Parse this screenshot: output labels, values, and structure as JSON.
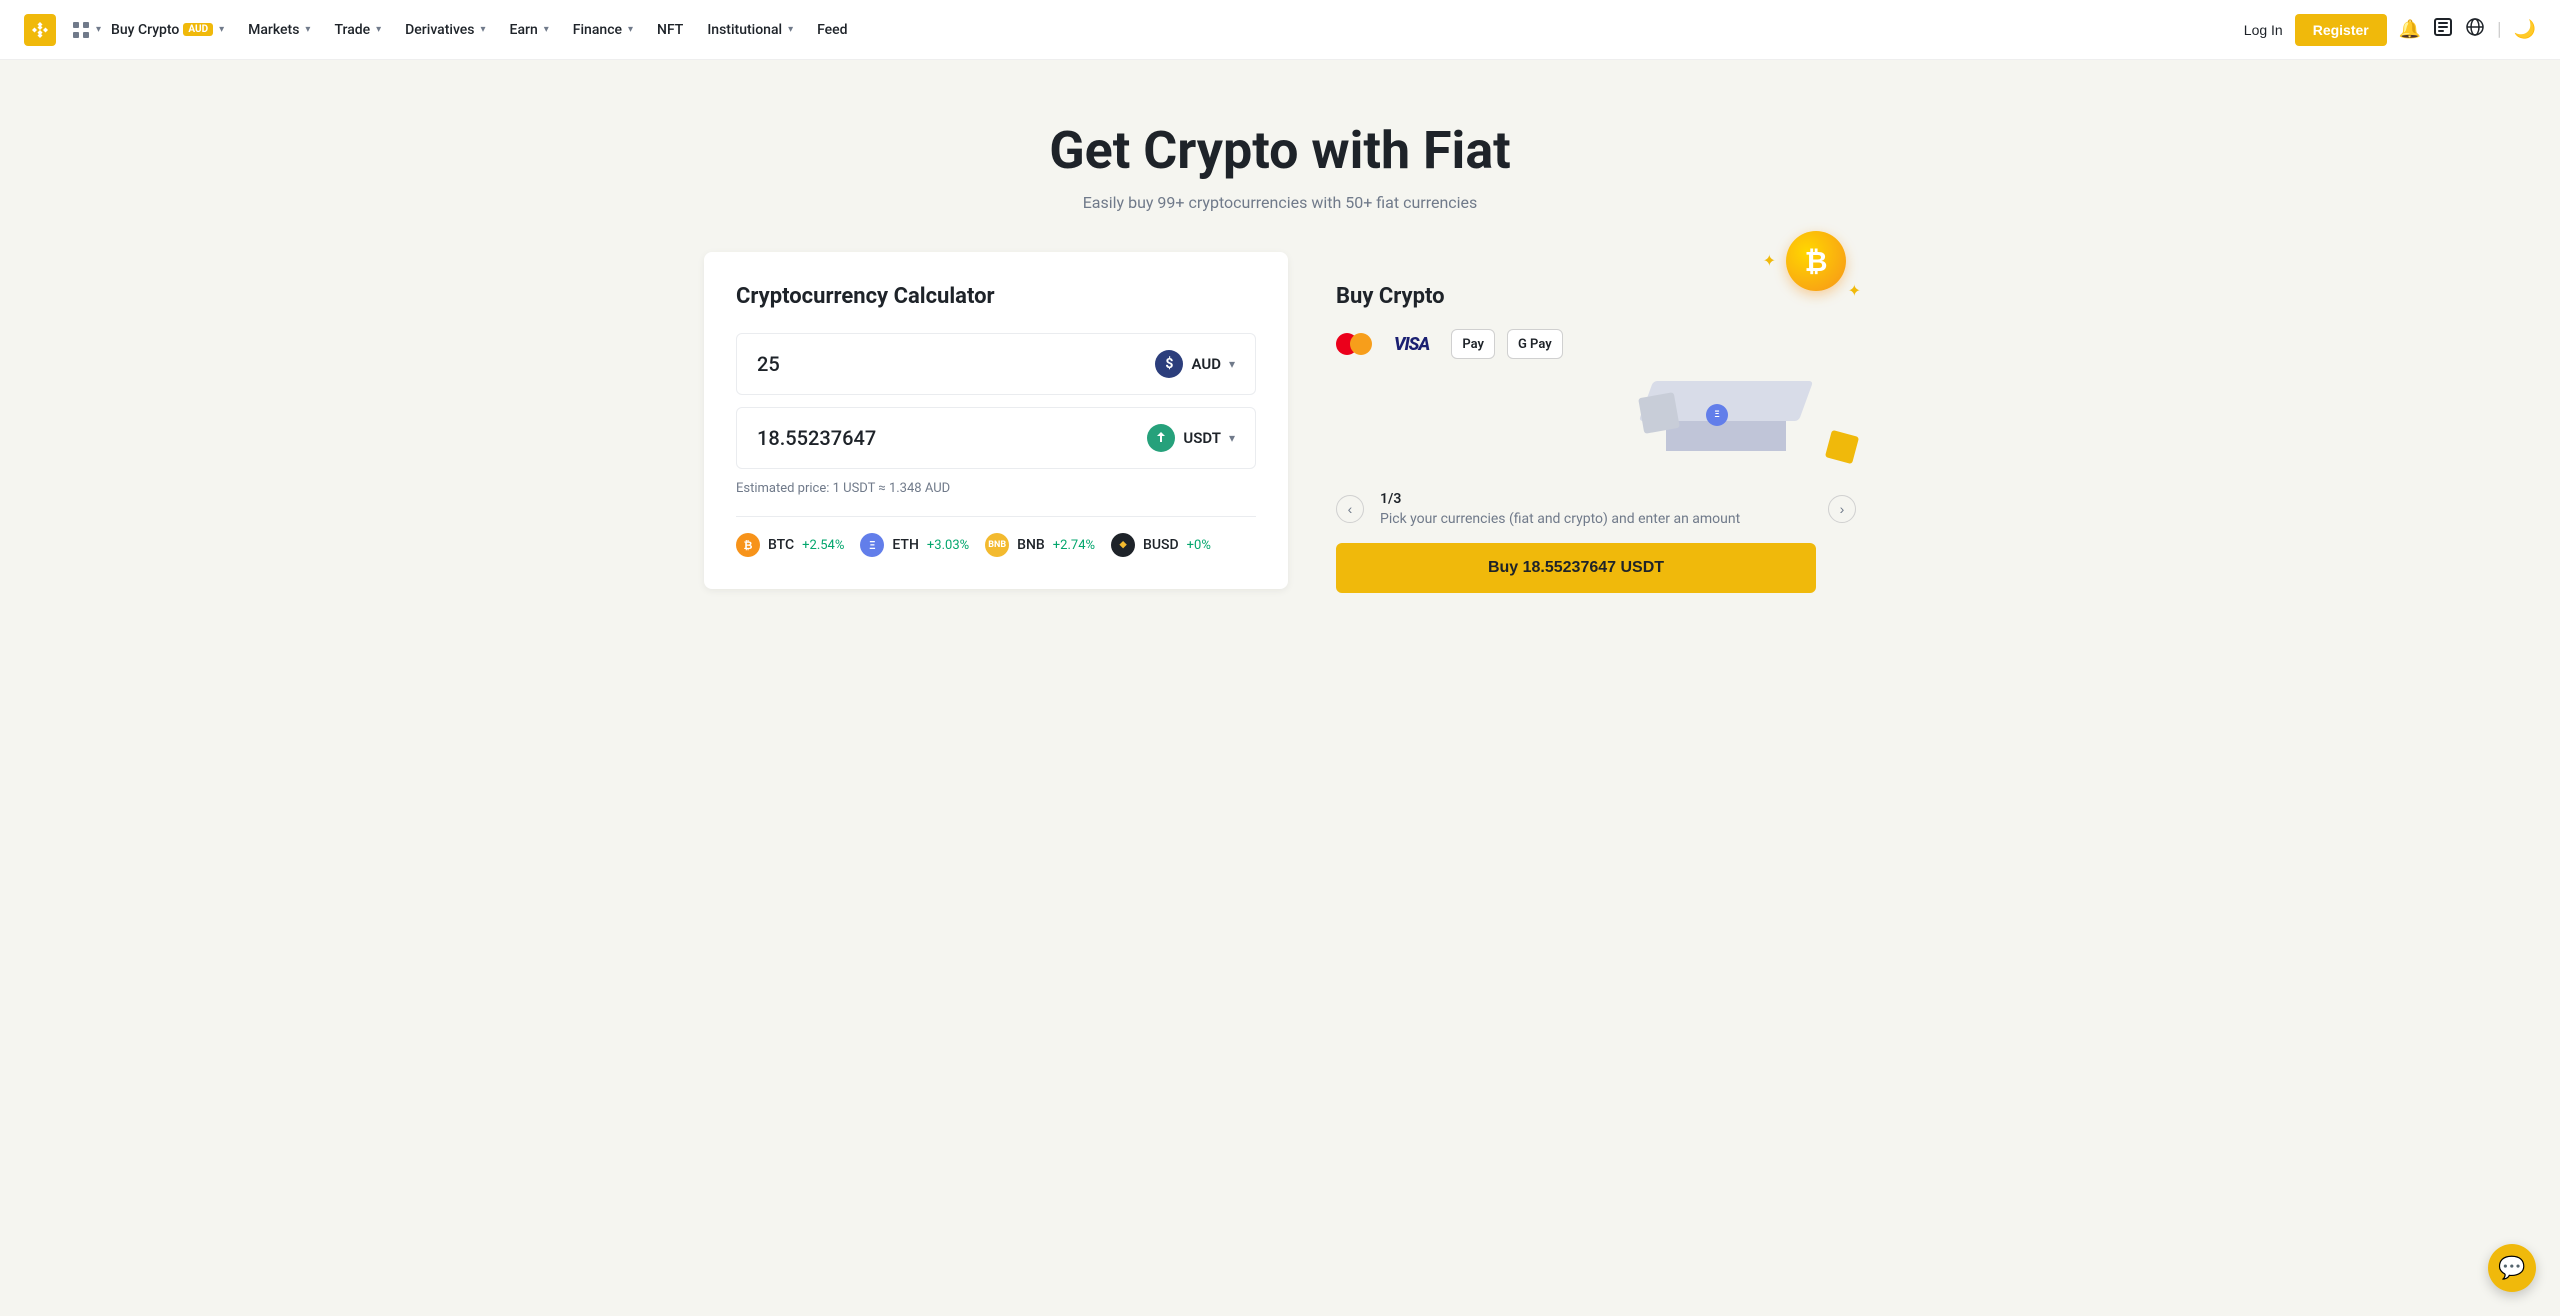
{
  "nav": {
    "logo_text": "BINANCE",
    "menu_items": [
      {
        "label": "Buy Crypto",
        "badge": "AUD",
        "has_chevron": true
      },
      {
        "label": "Markets",
        "has_chevron": true
      },
      {
        "label": "Trade",
        "has_chevron": true
      },
      {
        "label": "Derivatives",
        "has_chevron": true
      },
      {
        "label": "Earn",
        "has_chevron": true
      },
      {
        "label": "Finance",
        "has_chevron": true
      },
      {
        "label": "NFT",
        "has_chevron": false
      },
      {
        "label": "Institutional",
        "has_chevron": true
      },
      {
        "label": "Feed",
        "has_chevron": false
      }
    ],
    "login_label": "Log In",
    "register_label": "Register"
  },
  "hero": {
    "title": "Get Crypto with Fiat",
    "subtitle": "Easily buy 99+ cryptocurrencies with 50+ fiat currencies"
  },
  "calculator": {
    "title": "Cryptocurrency Calculator",
    "spend_value": "25",
    "spend_currency": "AUD",
    "receive_value": "18.55237647",
    "receive_currency": "USDT",
    "estimated_price": "Estimated price: 1 USDT ≈ 1.348 AUD",
    "tickers": [
      {
        "symbol": "BTC",
        "change": "+2.54%"
      },
      {
        "symbol": "ETH",
        "change": "+3.03%"
      },
      {
        "symbol": "BNB",
        "change": "+2.74%"
      },
      {
        "symbol": "BUSD",
        "change": "+0%"
      }
    ]
  },
  "buy_crypto": {
    "title": "Buy Crypto",
    "payment_methods": [
      "Mastercard",
      "Visa",
      "Apple Pay",
      "Google Pay"
    ],
    "carousel": {
      "current": "1",
      "total": "3",
      "description": "Pick your currencies (fiat and crypto) and enter an amount"
    },
    "buy_button_label": "Buy 18.55237647 USDT"
  },
  "icons": {
    "grid": "⊞",
    "bell": "🔔",
    "user": "👤",
    "globe": "🌐",
    "moon": "🌙",
    "chat": "💬",
    "chevron_down": "▾",
    "chevron_left": "‹",
    "chevron_right": "›",
    "bitcoin": "₿",
    "diamond": "◆"
  }
}
